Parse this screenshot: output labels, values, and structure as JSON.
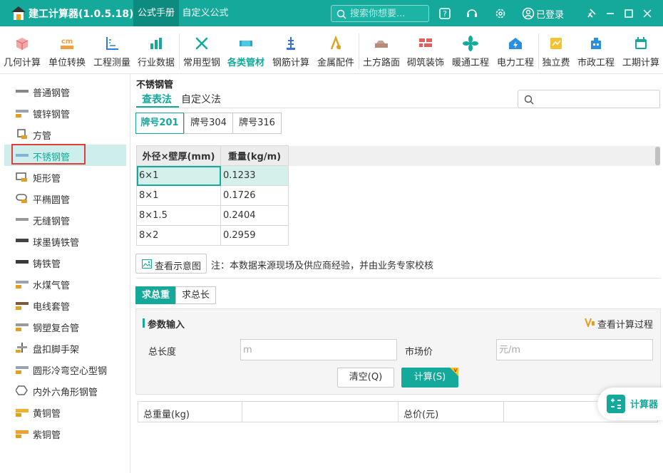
{
  "app": {
    "title": "建工计算器(1.0.5.18)",
    "tabs": [
      {
        "label": "公式手册"
      },
      {
        "label": "自定义公式"
      }
    ],
    "search_placeholder": "搜索你想要...",
    "login": "已登录",
    "brand_color": "#14a99a"
  },
  "toolbar": {
    "items": [
      {
        "label": "几何计算",
        "icon": "cube-icon"
      },
      {
        "label": "单位转换",
        "icon": "cm-ruler-icon"
      },
      {
        "label": "工程测量",
        "icon": "measure-icon"
      },
      {
        "label": "行业数据",
        "icon": "bar-chart-icon"
      },
      {
        "label": "常用型钢",
        "icon": "wrench-icon"
      },
      {
        "label": "各类管材",
        "icon": "pipe-icon"
      },
      {
        "label": "钢筋计算",
        "icon": "rebar-icon"
      },
      {
        "label": "金属配件",
        "icon": "metal-fitting-icon"
      },
      {
        "label": "土方路面",
        "icon": "road-icon"
      },
      {
        "label": "砌筑装饰",
        "icon": "brick-icon"
      },
      {
        "label": "暖通工程",
        "icon": "fan-icon"
      },
      {
        "label": "电力工程",
        "icon": "power-house-icon"
      },
      {
        "label": "独立费",
        "icon": "fee-icon"
      },
      {
        "label": "市政工程",
        "icon": "municipal-icon"
      },
      {
        "label": "工期计算",
        "icon": "calendar-icon"
      }
    ]
  },
  "sidebar": {
    "items": [
      {
        "label": "普通钢管",
        "icon": "pipe-icon",
        "vip": false
      },
      {
        "label": "镀锌钢管",
        "icon": "pipe-icon",
        "vip": true
      },
      {
        "label": "方管",
        "icon": "square-tube-icon",
        "vip": true
      },
      {
        "label": "不锈钢管",
        "icon": "pipe-icon",
        "vip": false
      },
      {
        "label": "矩形管",
        "icon": "rect-tube-icon",
        "vip": true
      },
      {
        "label": "平椭圆管",
        "icon": "oval-tube-icon",
        "vip": true
      },
      {
        "label": "无缝钢管",
        "icon": "pipe-icon",
        "vip": false
      },
      {
        "label": "球墨铸铁管",
        "icon": "pipe-icon",
        "vip": false
      },
      {
        "label": "铸铁管",
        "icon": "pipe-icon",
        "vip": false
      },
      {
        "label": "水煤气管",
        "icon": "pipe-icon",
        "vip": true
      },
      {
        "label": "电线套管",
        "icon": "pipe-icon",
        "vip": true
      },
      {
        "label": "钢塑复合管",
        "icon": "pipe-icon",
        "vip": true
      },
      {
        "label": "盘扣脚手架",
        "icon": "scaffold-icon",
        "vip": true
      },
      {
        "label": "圆形冷弯空心型钢",
        "icon": "pipe-icon",
        "vip": true
      },
      {
        "label": "内外六角形钢管",
        "icon": "hexagon-icon",
        "vip": true
      },
      {
        "label": "黄铜管",
        "icon": "brass-pipe-icon",
        "vip": true
      },
      {
        "label": "紫铜管",
        "icon": "copper-pipe-icon",
        "vip": true
      }
    ]
  },
  "main": {
    "title": "不锈钢管",
    "mode_tabs": [
      {
        "label": "查表法"
      },
      {
        "label": "自定义法"
      }
    ],
    "grade_tabs": [
      {
        "label": "牌号201"
      },
      {
        "label": "牌号304"
      },
      {
        "label": "牌号316"
      }
    ],
    "table": {
      "headers": [
        "外径×壁厚(mm)",
        "重量(kg/m)"
      ],
      "rows": [
        [
          "6×1",
          "0.1233"
        ],
        [
          "8×1",
          "0.1726"
        ],
        [
          "8×1.5",
          "0.2404"
        ],
        [
          "8×2",
          "0.2959"
        ]
      ]
    },
    "diagram_button": "查看示意图",
    "note": "注：本数据来源现场及供应商经验，并由业务专家校核",
    "calc_tabs": [
      {
        "label": "求总重"
      },
      {
        "label": "求总长"
      }
    ],
    "params": {
      "title": "参数输入",
      "view_process": "查看计算过程",
      "length_label": "总长度",
      "length_placeholder": "m",
      "price_label": "市场价",
      "price_placeholder": "元/m",
      "clear_button": "清空(Q)",
      "calc_button": "计算(S)"
    },
    "results": {
      "weight_label": "总重量(kg)",
      "price_label": "总价(元)"
    },
    "widget_label": "计算器"
  }
}
